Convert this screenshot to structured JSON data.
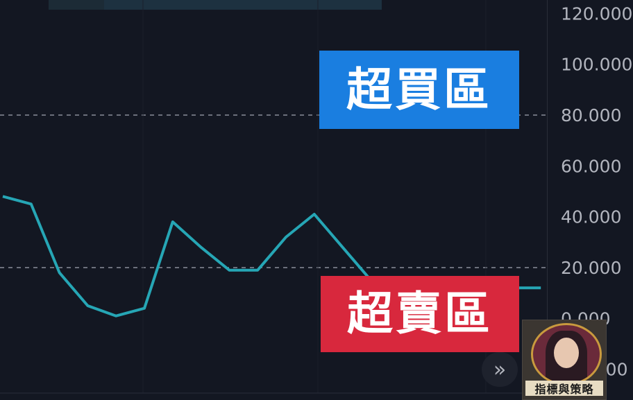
{
  "chart_data": {
    "type": "line",
    "y_ticks": [
      "120.000",
      "100.000",
      "80.000",
      "60.000",
      "40.000",
      "20.000",
      "0.000",
      "-20.000"
    ],
    "ylim": [
      -20,
      120
    ],
    "ref_lines": [
      80,
      20
    ],
    "series": [
      {
        "color": "#26a6b5",
        "points": [
          [
            0,
            48
          ],
          [
            1,
            45
          ],
          [
            2,
            18
          ],
          [
            3,
            5
          ],
          [
            4,
            1
          ],
          [
            5,
            4
          ],
          [
            6,
            38
          ],
          [
            7,
            28
          ],
          [
            8,
            19
          ],
          [
            9,
            19
          ],
          [
            10,
            32
          ],
          [
            11,
            41
          ],
          [
            12,
            28
          ],
          [
            13,
            15
          ],
          [
            14,
            8
          ],
          [
            15,
            8
          ],
          [
            16,
            10
          ],
          [
            17,
            14
          ],
          [
            18,
            12
          ],
          [
            19,
            12
          ]
        ]
      }
    ],
    "overbought_label": "超買區",
    "oversold_label": "超賣區",
    "colors": {
      "background": "#131722",
      "line": "#26a6b5",
      "overbought_badge": "#1a7ee0",
      "oversold_badge": "#d8283d",
      "grid_dash": "#8a8e99",
      "tick_text": "#b2b5be"
    }
  },
  "controls": {
    "scroll_icon": "double-chevron-right-icon",
    "scroll_glyph": "»"
  },
  "watermark": {
    "text": "指標與策略"
  }
}
